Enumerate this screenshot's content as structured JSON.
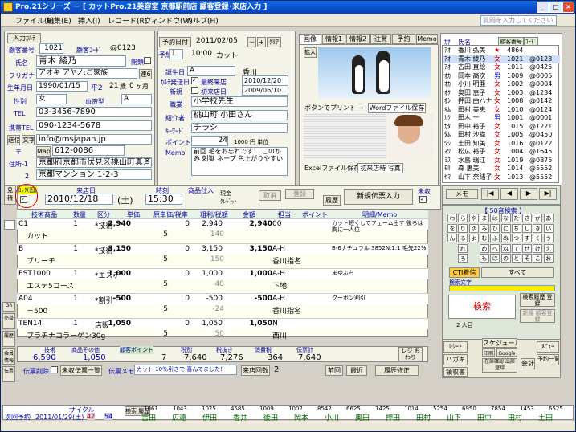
{
  "window": {
    "title": "Pro.21シリーズ － [ カットPro.21美容室 京都駅前店 顧客登録･来店入力 ]"
  },
  "menu": [
    "ファイル(F)",
    "編集(E)",
    "挿入(I)",
    "レコード(R)",
    "ウィンドウ(W)",
    "ヘルプ(H)"
  ],
  "help_placeholder": "質問を入力してください",
  "customer": {
    "entry_button": "入力ｶﾙﾃ",
    "number_label": "顧客番号",
    "number": "1021",
    "code_label": "顧客ｺｰﾄﾞ",
    "code": "@0123",
    "closed_label": "閉鎖",
    "name_label": "氏名",
    "name": "青木 綾乃",
    "furigana_label": "フリガナ",
    "furigana": "アオキ アヤノ:ご家族",
    "link_btn": "連6",
    "birth_label": "生年月日",
    "birth": "1990/01/15",
    "era": "平2",
    "age": "21",
    "age_unit": "歳",
    "months": "0",
    "month_unit": "ヶ月",
    "gender_label": "性別",
    "gender": "女",
    "blood_label": "血液型",
    "blood": "A",
    "tel_label": "TEL",
    "tel": "03-3456-7890",
    "mobile_label": "携帯TEL",
    "mobile": "090-1234-5678",
    "mail_btn1": "送信",
    "mail_btn2": "文字",
    "mail": "info@msjapan.jp",
    "zip_label": "〒",
    "map_btn": "Map",
    "zip": "612-0086",
    "address_label": "住所-1",
    "addr1": "京都府京都市伏見区桃山町真斉",
    "address2_label": "2",
    "addr2": "京都マンション 1-2-3"
  },
  "reservation": {
    "date_btn": "予約日付",
    "date": "2011/02/05",
    "minus": "－",
    "plus": "+",
    "clear": "ｸﾘｱ",
    "slot_label": "予約",
    "slot": "1",
    "time": "10:00",
    "menu": "カット"
  },
  "info": {
    "dm_label": "誕生日",
    "dm": "A",
    "store": "香川",
    "vip_label": "ｶﾙﾃ発送日",
    "vip_check": "最終来店",
    "last_visit": "2010/12/20",
    "new_label": "新規",
    "first_check": "初来店日",
    "first_visit": "2009/06/10",
    "job_label": "職業",
    "job": "小学校先生",
    "intro_label": "紹介者",
    "intro": "桃山町 小田さん",
    "keyword_label": "ｷｰﾜｰﾄﾞ",
    "keyword": "チラシ",
    "point_label": "ポイント",
    "points": "24",
    "point_unit": "1000 円 単位",
    "memo_label": "Memo",
    "memo": "前回 毛をお忘れです！ このかみ 刺獄 ネープ 色上がりやすい"
  },
  "tabs": [
    "画像",
    "情報1",
    "情報2",
    "注賞",
    "予約",
    "Memo"
  ],
  "images": {
    "enlarge1": "拡大",
    "enlarge2": "拡大",
    "print": "ボタンでプリント →",
    "word": "Wordファイル保存",
    "excel": "Excelファイル保存",
    "photo": "初来店時 写真"
  },
  "customer_list": {
    "col_kana": "ｶﾅ",
    "col_name": "氏名",
    "col_no": "顧客番号",
    "col_code": "ｺｰﾄﾞ",
    "rows": [
      {
        "k": "ｱｵ",
        "n": "香川 弘美",
        "s": "★",
        "no": "4864",
        "c": ""
      },
      {
        "k": "ｱｵ",
        "n": "青木 綾乃",
        "s": "女",
        "no": "1021",
        "c": "@0123"
      },
      {
        "k": "ｱｵ",
        "n": "古田 直絵",
        "s": "女",
        "no": "1011",
        "c": "@0425"
      },
      {
        "k": "ｵｶ",
        "n": "岡本 高次",
        "s": "男",
        "no": "1009",
        "c": "@0005"
      },
      {
        "k": "ｵｶ",
        "n": "小川 明亜",
        "s": "女",
        "no": "1002",
        "c": "@0004"
      },
      {
        "k": "ｵｸ",
        "n": "奥田 恵子",
        "s": "女",
        "no": "1003",
        "c": "@1234"
      },
      {
        "k": "ｵｼ",
        "n": "押田 由ハナ",
        "s": "女",
        "no": "1008",
        "c": "@0142"
      },
      {
        "k": "ｷﾑ",
        "n": "田村 美恵",
        "s": "女",
        "no": "1010",
        "c": "@0124"
      },
      {
        "k": "ｶｸ",
        "n": "田木 一",
        "s": "男",
        "no": "1001",
        "c": "@0001"
      },
      {
        "k": "ｶﾀ",
        "n": "田中 裕子",
        "s": "女",
        "no": "1015",
        "c": "@1221"
      },
      {
        "k": "ﾀﾑ",
        "n": "田村 沙織",
        "s": "女",
        "no": "1005",
        "c": "@0450"
      },
      {
        "k": "ﾂｼ",
        "n": "土田 知美",
        "s": "女",
        "no": "1016",
        "c": "@0122"
      },
      {
        "k": "ﾏﾂ",
        "n": "松広 裕子",
        "s": "女",
        "no": "1004",
        "c": "@1645"
      },
      {
        "k": "ﾐｽ",
        "n": "水島 瑞江",
        "s": "女",
        "no": "1019",
        "c": "@0875"
      },
      {
        "k": "ﾓﾘ",
        "n": "森 恵美",
        "s": "女",
        "no": "1014",
        "c": "@5552"
      },
      {
        "k": "ﾔﾏ",
        "n": "山下 奈緒子",
        "s": "女",
        "no": "1013",
        "c": "@5552"
      }
    ]
  },
  "visit": {
    "lock_label": "ﾛｯｸ(固)",
    "date_label": "来店日",
    "date": "2010/12/18",
    "weekday": "(土)",
    "time_label": "時刻",
    "time": "15:30",
    "product_label": "商品仕入",
    "cash": "現金",
    "credit": "ｸﾚｼﾞｯﾄ",
    "cancel": "取消",
    "register": "登録",
    "history": "履歴",
    "new_slip": "新規伝票入力",
    "unsettled": "未収"
  },
  "grid": {
    "headers": [
      "技術商品",
      "数量",
      "区分",
      "単価",
      "原単価/税率",
      "粗利/税額",
      "金額",
      "担当",
      "ポイント",
      "明細/Memo"
    ],
    "rows": [
      {
        "code": "C1",
        "qty": "1",
        "type": "*技術",
        "price": "2,940",
        "cost": "0",
        "gross": "2,940",
        "amt": "2,940",
        "staff": "00",
        "memo": "カット短くしてフェーム出す 後ろは胸に一人位",
        "sub": "カット",
        "tax": "5",
        "tax_amt": "140"
      },
      {
        "code": "B",
        "qty": "1",
        "type": "*技術",
        "price": "3,150",
        "cost": "0",
        "gross": "3,150",
        "amt": "3,150",
        "staff": "A-H",
        "memo": "B-6ナチュラル 3852N:1:1 毛先22%",
        "sub": "ブリーチ",
        "tax": "5",
        "tax_amt": "150",
        "staff2": "香川指名"
      },
      {
        "code": "EST1000",
        "qty": "1",
        "type": "*エステ",
        "price": "1,000",
        "cost": "0",
        "gross": "1,000",
        "amt": "1,000",
        "staff": "A-H",
        "memo": "まゆぶち",
        "sub": "エステ5コース",
        "tax": "5",
        "tax_amt": "48",
        "staff2": "下地"
      },
      {
        "code": "A04",
        "qty": "1",
        "type": "*割引",
        "price": "-500",
        "cost": "0",
        "gross": "-500",
        "amt": "-500",
        "staff": "A-H",
        "memo": "クーポン割引",
        "sub": "－500",
        "tax": "5",
        "tax_amt": "-24",
        "staff2": "香川指名"
      },
      {
        "code": "TEN14",
        "qty": "1",
        "type": "店販",
        "price": "1,050",
        "cost": "0",
        "gross": "1,050",
        "amt": "1,050",
        "staff": "N",
        "memo": "",
        "sub": "プラチナコラーゲン30g",
        "tax": "5",
        "tax_amt": "50",
        "staff2": "西川"
      }
    ]
  },
  "totals": {
    "tech_label": "技術",
    "prod_label": "商品その他",
    "point_label": "顧客ポイント",
    "tax_label": "税別",
    "taxin_label": "税抜き",
    "consume_label": "消費税",
    "slip_label": "伝票計",
    "tech": "6,590",
    "prod": "1,050",
    "points": "7",
    "net": "7,640",
    "taxin": "7,276",
    "tax": "364",
    "total": "7,640",
    "register_btn": "レジ おわり"
  },
  "actions": {
    "slip_delete": "伝票削除",
    "unsettled_list": "未収伝票一覧",
    "slip_memo": "伝票メモ",
    "memo_text": "カット 10％引きで 喜んでました！",
    "visit_count_label": "来店回数",
    "visit_count": "2",
    "prev": "前回",
    "recent": "最近",
    "history_edit": "履歴修正"
  },
  "right_panel": {
    "memo": "メモ",
    "kana_title": "【 50音検索 】",
    "cti": "CTI着信",
    "all": "すべて",
    "search_label": "検索文字",
    "search": "検索",
    "input2": "2 人目",
    "history_btn": "検索履歴 登録",
    "new_customer": "新規 顧客登録"
  },
  "bottom_buttons": [
    "ﾚｼｰﾄ",
    "スケジュール",
    "印刷",
    "Google",
    "ﾒﾆｭｰ",
    "予約一覧",
    "ハガキ",
    "在庫確認 出庫登録",
    "会計",
    "店外データ",
    "領収書"
  ],
  "side_buttons": [
    "見積",
    "GR",
    "売掛",
    "履歴",
    "会員情報",
    "伝票"
  ],
  "kana": [
    "わ",
    "ら",
    "や",
    "ま",
    "は",
    "な",
    "た",
    "さ",
    "か",
    "あ",
    "を",
    "り",
    "ゆ",
    "み",
    "ひ",
    "に",
    "ち",
    "し",
    "き",
    "い",
    "ん",
    "る",
    "よ",
    "む",
    "ふ",
    "ぬ",
    "つ",
    "す",
    "く",
    "う",
    "",
    "れ",
    "",
    "め",
    "へ",
    "ね",
    "て",
    "せ",
    "け",
    "え",
    "",
    "ろ",
    "",
    "も",
    "ほ",
    "の",
    "と",
    "そ",
    "こ",
    "お"
  ],
  "bottom_bar": {
    "label": "次回予約",
    "date": "2011/01/29(土)",
    "cycle": "サイクル",
    "c1": "42",
    "c2": "54",
    "nums": [
      "1061",
      "1043",
      "1025",
      "4585",
      "1009",
      "1002",
      "8542",
      "6625",
      "1425",
      "1014",
      "5254",
      "6950",
      "7854",
      "1453",
      "6525"
    ],
    "names": [
      "吉田",
      "広遠",
      "伊田",
      "香井",
      "後田",
      "岡本",
      "小川",
      "奥田",
      "押田",
      "田村",
      "山下",
      "田中",
      "田村",
      "土田"
    ],
    "search_label": "検索 履歴"
  },
  "colors": {
    "title": "#0a3fbf",
    "label": "#0000a0",
    "red": "#cc0000",
    "accent": "#e00000"
  }
}
